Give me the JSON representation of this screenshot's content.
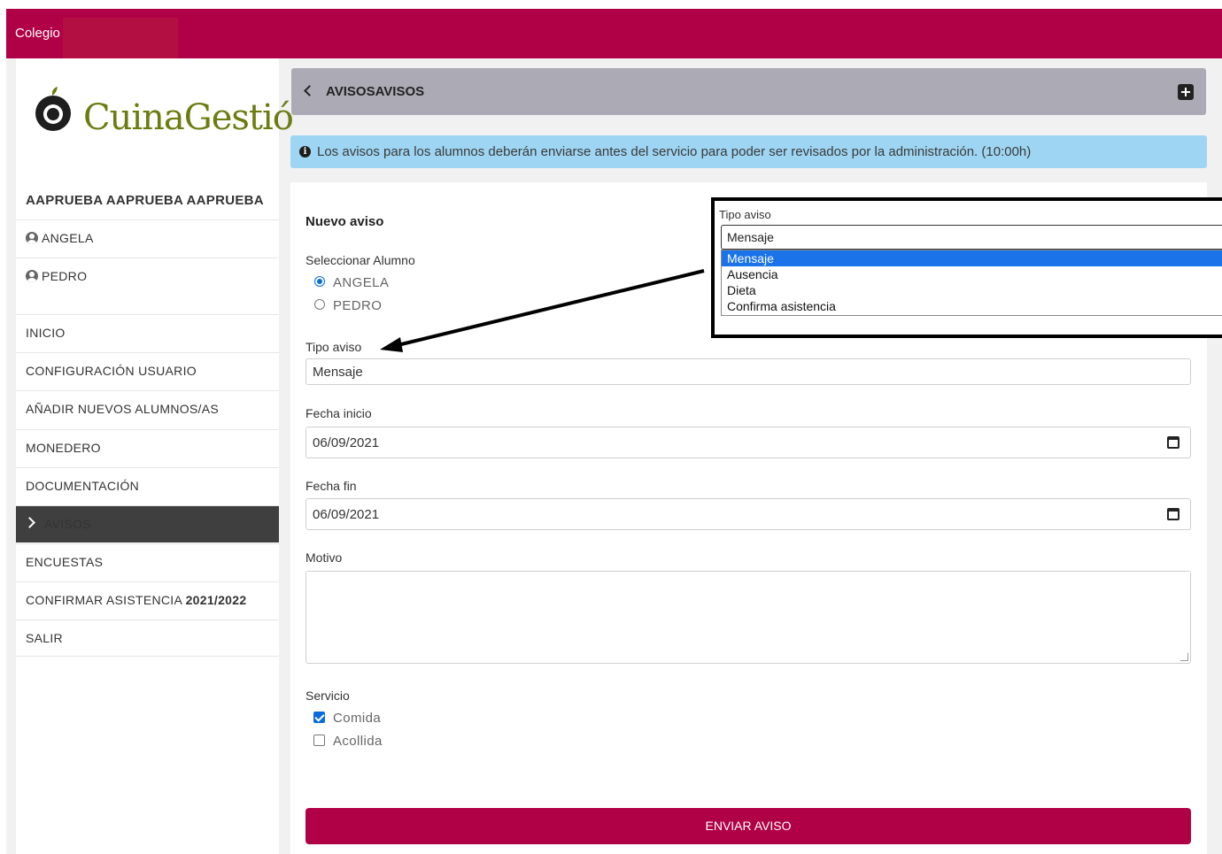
{
  "topbar": {
    "school": "Colegio"
  },
  "logo": {
    "text": "CuinaGestió"
  },
  "sidebar": {
    "user_header": "AAPRUEBA AAPRUEBA AAPRUEBA",
    "students": [
      "ANGELA",
      "PEDRO"
    ],
    "menu": [
      {
        "label": "INICIO"
      },
      {
        "label": "CONFIGURACIÓN USUARIO"
      },
      {
        "label": "AÑADIR NUEVOS ALUMNOS/AS"
      },
      {
        "label": "MONEDERO"
      },
      {
        "label": "DOCUMENTACIÓN"
      },
      {
        "label": "AVISOS"
      },
      {
        "label": "ENCUESTAS"
      },
      {
        "label": "CONFIRMAR ASISTENCIA ",
        "suffix": "2021/2022"
      },
      {
        "label": "SALIR"
      }
    ]
  },
  "header": {
    "title": "AVISOSAVISOS"
  },
  "info": {
    "text": "Los avisos para los alumnos deberán enviarse antes del servicio para poder ser revisados por la administración. (10:00h)"
  },
  "form": {
    "title": "Nuevo aviso",
    "student_label": "Seleccionar Alumno",
    "students": [
      "ANGELA",
      "PEDRO"
    ],
    "tipo_label": "Tipo aviso",
    "tipo_value": "Mensaje",
    "fecha_inicio_label": "Fecha inicio",
    "fecha_inicio_value": "06/09/2021",
    "fecha_fin_label": "Fecha fin",
    "fecha_fin_value": "06/09/2021",
    "motivo_label": "Motivo",
    "servicio_label": "Servicio",
    "servicios": [
      "Comida",
      "Acollida"
    ],
    "submit": "ENVIAR AVISO"
  },
  "callout": {
    "label": "Tipo aviso",
    "value": "Mensaje",
    "options": [
      "Mensaje",
      "Ausencia",
      "Dieta",
      "Confirma asistencia"
    ]
  },
  "colors": {
    "brand": "#b00046",
    "info": "#9ed5f2",
    "header": "#acaab5",
    "selected_option": "#1a73e8"
  }
}
